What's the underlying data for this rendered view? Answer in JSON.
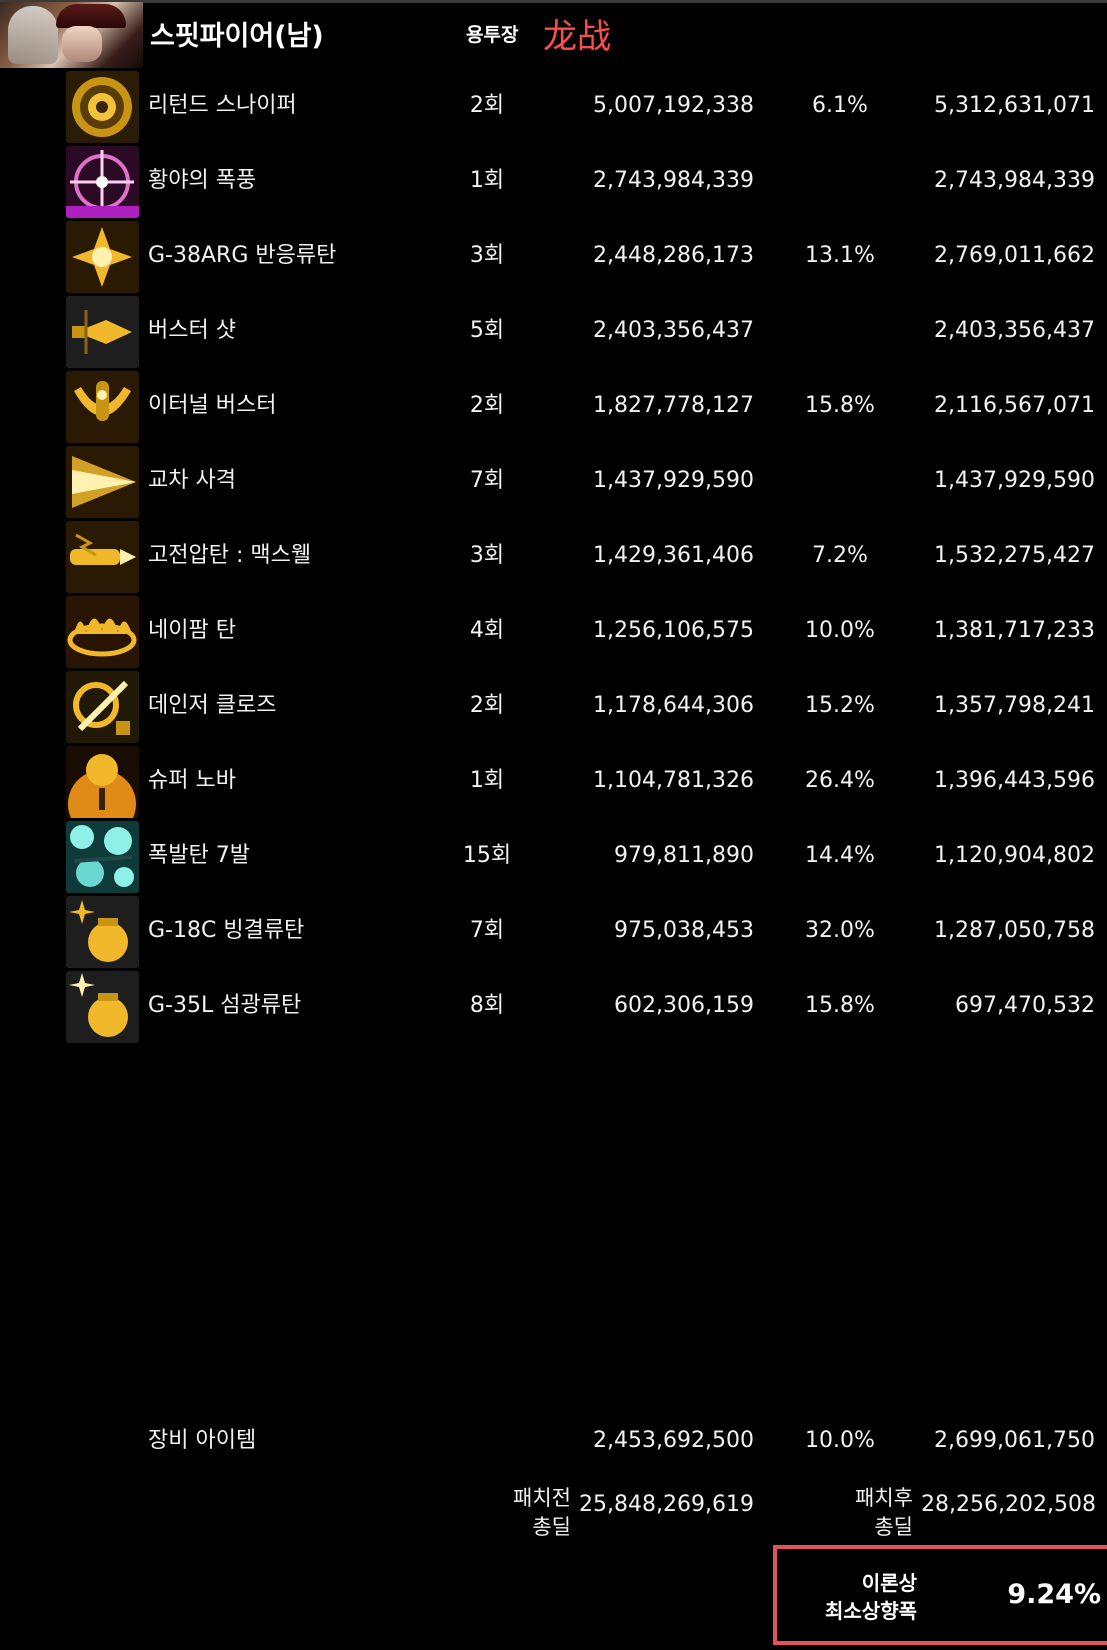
{
  "header": {
    "character_name": "스핏파이어(남)",
    "mode_label": "용투장",
    "server_label": "龙战"
  },
  "skills": [
    {
      "name": "리턴드 스나이퍼",
      "count": "2회",
      "damage": "5,007,192,338",
      "increase": "6.1%",
      "after": "5,312,631,071",
      "icon": "returned-sniper-icon"
    },
    {
      "name": "황야의 폭풍",
      "count": "1회",
      "damage": "2,743,984,339",
      "increase": "",
      "after": "2,743,984,339",
      "icon": "wilderness-storm-icon"
    },
    {
      "name": "G-38ARG 반응류탄",
      "count": "3회",
      "damage": "2,448,286,173",
      "increase": "13.1%",
      "after": "2,769,011,662",
      "icon": "g38arg-grenade-icon"
    },
    {
      "name": "버스터 샷",
      "count": "5회",
      "damage": "2,403,356,437",
      "increase": "",
      "after": "2,403,356,437",
      "icon": "buster-shot-icon"
    },
    {
      "name": "이터널 버스터",
      "count": "2회",
      "damage": "1,827,778,127",
      "increase": "15.8%",
      "after": "2,116,567,071",
      "icon": "eternal-buster-icon"
    },
    {
      "name": "교차 사격",
      "count": "7회",
      "damage": "1,437,929,590",
      "increase": "",
      "after": "1,437,929,590",
      "icon": "cross-fire-icon"
    },
    {
      "name": "고전압탄 : 맥스웰",
      "count": "3회",
      "damage": "1,429,361,406",
      "increase": "7.2%",
      "after": "1,532,275,427",
      "icon": "high-voltage-maxwell-icon"
    },
    {
      "name": "네이팜 탄",
      "count": "4회",
      "damage": "1,256,106,575",
      "increase": "10.0%",
      "after": "1,381,717,233",
      "icon": "napalm-icon"
    },
    {
      "name": "데인저 클로즈",
      "count": "2회",
      "damage": "1,178,644,306",
      "increase": "15.2%",
      "after": "1,357,798,241",
      "icon": "danger-close-icon"
    },
    {
      "name": "슈퍼 노바",
      "count": "1회",
      "damage": "1,104,781,326",
      "increase": "26.4%",
      "after": "1,396,443,596",
      "icon": "super-nova-icon"
    },
    {
      "name": "폭발탄 7발",
      "count": "15회",
      "damage": "979,811,890",
      "increase": "14.4%",
      "after": "1,120,904,802",
      "icon": "explosive-rounds-icon"
    },
    {
      "name": "G-18C 빙결류탄",
      "count": "7회",
      "damage": "975,038,453",
      "increase": "32.0%",
      "after": "1,287,050,758",
      "icon": "g18c-freeze-grenade-icon"
    },
    {
      "name": "G-35L 섬광류탄",
      "count": "8회",
      "damage": "602,306,159",
      "increase": "15.8%",
      "after": "697,470,532",
      "icon": "g35l-flash-grenade-icon"
    }
  ],
  "equipment": {
    "name": "장비 아이템",
    "damage": "2,453,692,500",
    "increase": "10.0%",
    "after": "2,699,061,750"
  },
  "totals": {
    "before_label_1": "패치전",
    "before_label_2": "총딜",
    "before_value": "25,848,269,619",
    "after_label_1": "패치후",
    "after_label_2": "총딜",
    "after_value": "28,256,202,508"
  },
  "result": {
    "label_1": "이론상",
    "label_2": "최소상향폭",
    "value": "9.24%",
    "accent": "#e2545d"
  }
}
